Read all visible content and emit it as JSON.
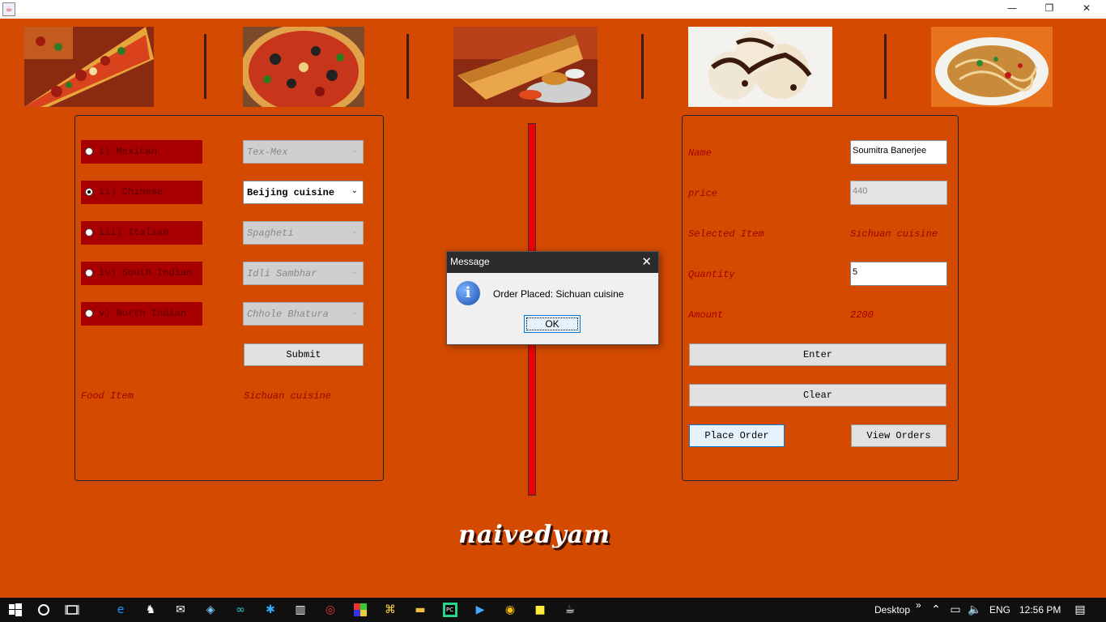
{
  "window": {
    "app_icon": "java-icon",
    "minimize": "—",
    "restore": "❐",
    "close": "✕"
  },
  "banner": [
    {
      "name": "pizza-slice-image",
      "alt": "pizza slice"
    },
    {
      "name": "pizza-image",
      "alt": "pizza"
    },
    {
      "name": "dosa-image",
      "alt": "dosa"
    },
    {
      "name": "ice-cream-image",
      "alt": "ice cream"
    },
    {
      "name": "noodles-image",
      "alt": "noodles"
    }
  ],
  "cuisines": [
    {
      "label": "i) Mexican",
      "dish": "Tex-Mex",
      "selected": false,
      "enabled": false
    },
    {
      "label": "ii) Chinese",
      "dish": "Beijing cuisine",
      "selected": true,
      "enabled": true
    },
    {
      "label": "iii) Italian",
      "dish": "Spagheti",
      "selected": false,
      "enabled": false
    },
    {
      "label": "iv) South Indian",
      "dish": "Idli Sambhar",
      "selected": false,
      "enabled": false
    },
    {
      "label": "v) North Indian",
      "dish": "Chhole Bhatura",
      "selected": false,
      "enabled": false
    }
  ],
  "left_panel": {
    "submit_label": "Submit",
    "food_item_label": "Food Item",
    "food_item_value": "Sichuan cuisine"
  },
  "right_panel": {
    "name_label": "Name",
    "name_value": "Soumitra Banerjee",
    "price_label": "price",
    "price_value": "440",
    "selected_item_label": "Selected Item",
    "selected_item_value": "Sichuan cuisine",
    "quantity_label": "Quantity",
    "quantity_value": "5",
    "amount_label": "Amount",
    "amount_value": "2200",
    "enter_label": "Enter",
    "clear_label": "Clear",
    "place_order_label": "Place Order",
    "view_orders_label": "View Orders"
  },
  "dialog": {
    "title": "Message",
    "message": "Order Placed: Sichuan cuisine",
    "ok_label": "OK",
    "close": "✕",
    "icon_glyph": "i"
  },
  "logo": "naivedyam",
  "taskbar": {
    "desktop_label": "Desktop",
    "language": "ENG",
    "time": "12:56 PM",
    "overflow": "»"
  },
  "colors": {
    "background": "#d44a00",
    "radio_bg": "#a80000",
    "label_red": "#a40000",
    "divider_red": "#ff0000"
  }
}
